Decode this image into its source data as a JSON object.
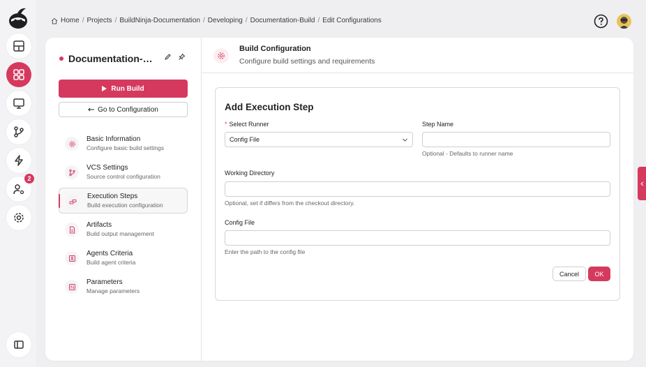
{
  "colors": {
    "accent": "#d6395e",
    "background": "#efeff1",
    "card": "#ffffff"
  },
  "rail": {
    "items": [
      {
        "name": "dashboard-icon",
        "active": false
      },
      {
        "name": "projects-icon",
        "active": true
      },
      {
        "name": "monitor-icon",
        "active": false
      },
      {
        "name": "vcs-branch-icon",
        "active": false
      },
      {
        "name": "lightning-icon",
        "active": false
      },
      {
        "name": "user-settings-icon",
        "active": false,
        "badge": "2"
      },
      {
        "name": "gear-icon",
        "active": false
      },
      {
        "name": "sidebar-toggle-icon",
        "active": false
      }
    ]
  },
  "breadcrumb": {
    "items": [
      "Home",
      "Projects",
      "BuildNinja-Documentation",
      "Developing",
      "Documentation-Build",
      "Edit Configurations"
    ],
    "separator": "/"
  },
  "sidepanel": {
    "title": "Documentation-Build",
    "run_label": "Run Build",
    "goto_label": "Go to Configuration",
    "nav": [
      {
        "title": "Basic Information",
        "subtitle": "Configure basic build settings",
        "icon": "gear-icon"
      },
      {
        "title": "VCS Settings",
        "subtitle": "Source control configuration",
        "icon": "vcs-branch-icon"
      },
      {
        "title": "Execution Steps",
        "subtitle": "Build execution configuration",
        "icon": "steps-icon",
        "active": true
      },
      {
        "title": "Artifacts",
        "subtitle": "Build output management",
        "icon": "file-icon"
      },
      {
        "title": "Agents Criteria",
        "subtitle": "Build agent criteria",
        "icon": "agent-icon"
      },
      {
        "title": "Parameters",
        "subtitle": "Manage parameters",
        "icon": "sliders-icon"
      }
    ]
  },
  "content": {
    "header_title": "Build Configuration",
    "header_subtitle": "Configure build settings and requirements",
    "form": {
      "title": "Add Execution Step",
      "runner_label": "Select Runner",
      "runner_value": "Config File",
      "step_name_label": "Step Name",
      "step_name_value": "",
      "step_name_hint": "Optional - Defaults to runner name",
      "workdir_label": "Working Directory",
      "workdir_value": "",
      "workdir_hint": "Optional, set if differs from the checkout directory.",
      "config_label": "Config File",
      "config_value": "",
      "config_hint": "Enter the path to the config file",
      "cancel_label": "Cancel",
      "ok_label": "OK"
    }
  }
}
